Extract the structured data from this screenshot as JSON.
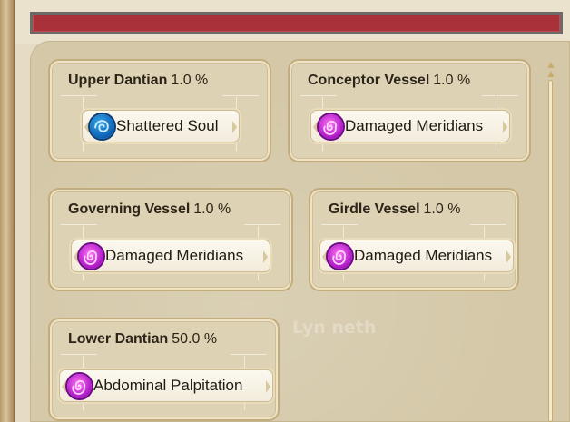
{
  "meridians": [
    {
      "name": "Upper Dantian",
      "percent": "1.0 %",
      "status": {
        "label": "Shattered Soul",
        "icon": "shattered-soul-icon",
        "color": "#1a7fd1"
      }
    },
    {
      "name": "Conceptor Vessel",
      "percent": "1.0 %",
      "status": {
        "label": "Damaged Meridians",
        "icon": "damaged-meridians-icon",
        "color": "#c22fd6"
      }
    },
    {
      "name": "Governing Vessel",
      "percent": "1.0 %",
      "status": {
        "label": "Damaged Meridians",
        "icon": "damaged-meridians-icon",
        "color": "#c22fd6"
      }
    },
    {
      "name": "Girdle Vessel",
      "percent": "1.0 %",
      "status": {
        "label": "Damaged Meridians",
        "icon": "damaged-meridians-icon",
        "color": "#c22fd6"
      }
    },
    {
      "name": "Lower Dantian",
      "percent": "50.0 %",
      "status": {
        "label": "Abdominal Palpitation",
        "icon": "abdominal-palpitation-icon",
        "color": "#c22fd6"
      }
    }
  ],
  "watermark": "Lyn neth",
  "colors": {
    "title_bar": "#a9323a",
    "panel": "#d4c8a8",
    "card": "#ddd2b4"
  }
}
